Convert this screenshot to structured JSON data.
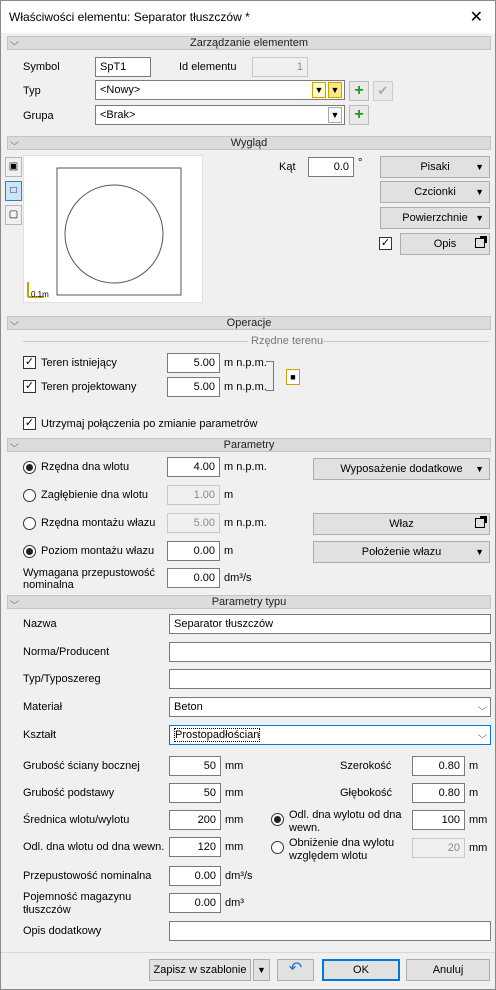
{
  "window": {
    "title": "Właściwości elementu: Separator tłuszczów *",
    "close": "✕"
  },
  "sections": {
    "zarzadzanie": "Zarządzanie elementem",
    "wyglad": "Wygląd",
    "operacje": "Operacje",
    "parametry": "Parametry",
    "parametry_typu": "Parametry typu"
  },
  "mgmt": {
    "symbol_label": "Symbol",
    "symbol_value": "SpT1",
    "id_label": "Id elementu",
    "id_value": "1",
    "typ_label": "Typ",
    "typ_value": "<Nowy>",
    "grupa_label": "Grupa",
    "grupa_value": "<Brak>"
  },
  "appearance": {
    "kat_label": "Kąt",
    "kat_value": "0.0",
    "kat_unit": "°",
    "pisaki": "Pisaki",
    "czcionki": "Czcionki",
    "powierzchnie": "Powierzchnie",
    "opis": "Opis",
    "scale": "0.1m"
  },
  "operations": {
    "rzedne": "Rzędne terenu",
    "teren_istniejacy": "Teren istniejący",
    "teren_istniejacy_value": "5.00",
    "unit1": "m n.p.m.",
    "teren_projektowany": "Teren projektowany",
    "teren_projektowany_value": "5.00",
    "unit2": "m n.p.m.",
    "utrzymaj": "Utrzymaj połączenia po zmianie parametrów"
  },
  "params": {
    "rzedna_dna": "Rzędna dna wlotu",
    "rzedna_dna_value": "4.00",
    "u1": "m n.p.m.",
    "zaglebienie": "Zagłębienie dna wlotu",
    "zaglebienie_value": "1.00",
    "u2": "m",
    "rzedna_montazu": "Rzędna montażu włazu",
    "rzedna_montazu_value": "5.00",
    "u3": "m n.p.m.",
    "poziom_montazu": "Poziom montażu włazu",
    "poziom_montazu_value": "0.00",
    "u4": "m",
    "wymagana_1": "Wymagana przepustowość",
    "wymagana_2": "nominalna",
    "wymagana_value": "0.00",
    "u5": "dm³/s",
    "wyposazenie": "Wyposażenie dodatkowe",
    "wlaz": "Właz",
    "polozenie": "Położenie włazu"
  },
  "type_params": {
    "nazwa": "Nazwa",
    "nazwa_value": "Separator tłuszczów",
    "norma": "Norma/Producent",
    "norma_value": "",
    "typ": "Typ/Typoszereg",
    "typ_value": "",
    "material": "Materiał",
    "material_value": "Beton",
    "ksztalt": "Kształt",
    "ksztalt_value": "Prostopadłościan",
    "grubosc_sciany": "Grubość ściany bocznej",
    "grubosc_sciany_value": "50",
    "gu1": "mm",
    "grubosc_podstawy": "Grubość podstawy",
    "grubosc_podstawy_value": "50",
    "gu2": "mm",
    "srednica": "Średnica wlotu/wylotu",
    "srednica_value": "200",
    "gu3": "mm",
    "odl_dna": "Odl. dna wlotu od dna wewn.",
    "odl_dna_value": "120",
    "gu4": "mm",
    "przepustowosc": "Przepustowość nominalna",
    "przepustowosc_value": "0.00",
    "gu5": "dm³/s",
    "pojemnosc_1": "Pojemność magazynu",
    "pojemnosc_2": "tłuszczów",
    "pojemnosc_value": "0.00",
    "gu6": "dm³",
    "opis_dod": "Opis dodatkowy",
    "opis_dod_value": "",
    "szerokosc": "Szerokość",
    "szerokosc_value": "0.80",
    "su1": "m",
    "glebokosc": "Głębokość",
    "glebokosc_value": "0.80",
    "su2": "m",
    "odl_wylotu_1": "Odl. dna wylotu od dna",
    "odl_wylotu_2": "wewn.",
    "odl_wylotu_value": "100",
    "su3": "mm",
    "obnizenie_1": "Obniżenie dna wylotu",
    "obnizenie_2": "względem wlotu",
    "obnizenie_value": "20",
    "su4": "mm"
  },
  "footer": {
    "zapisz": "Zapisz w szablonie",
    "ok": "OK",
    "anuluj": "Anuluj"
  }
}
